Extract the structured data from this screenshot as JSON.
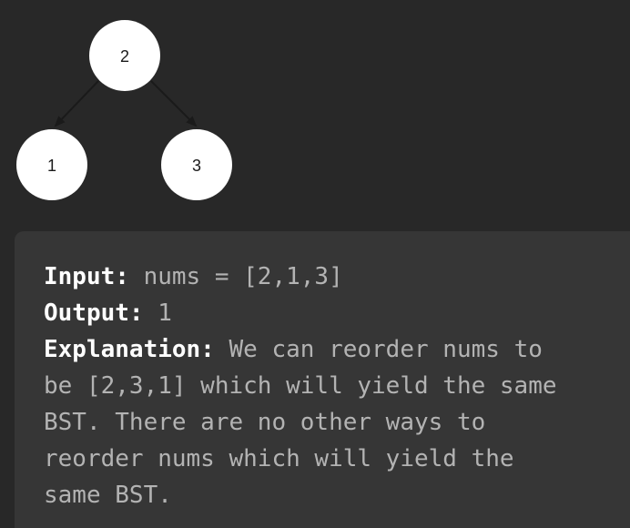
{
  "tree": {
    "nodes": [
      {
        "id": "root",
        "label": "2"
      },
      {
        "id": "left",
        "label": "1"
      },
      {
        "id": "right",
        "label": "3"
      }
    ],
    "colors": {
      "node_fill": "#ffffff",
      "edge": "#1a1a1a",
      "background": "#282828"
    }
  },
  "example": {
    "input_label": "Input:",
    "input_value": " nums = [2,1,3]",
    "output_label": "Output:",
    "output_value": " 1",
    "explanation_label": "Explanation:",
    "explanation_lines": [
      " We can reorder nums to",
      "be [2,3,1] which will yield the same",
      "BST. There are no other ways to",
      "reorder nums which will yield the",
      "same BST."
    ]
  }
}
